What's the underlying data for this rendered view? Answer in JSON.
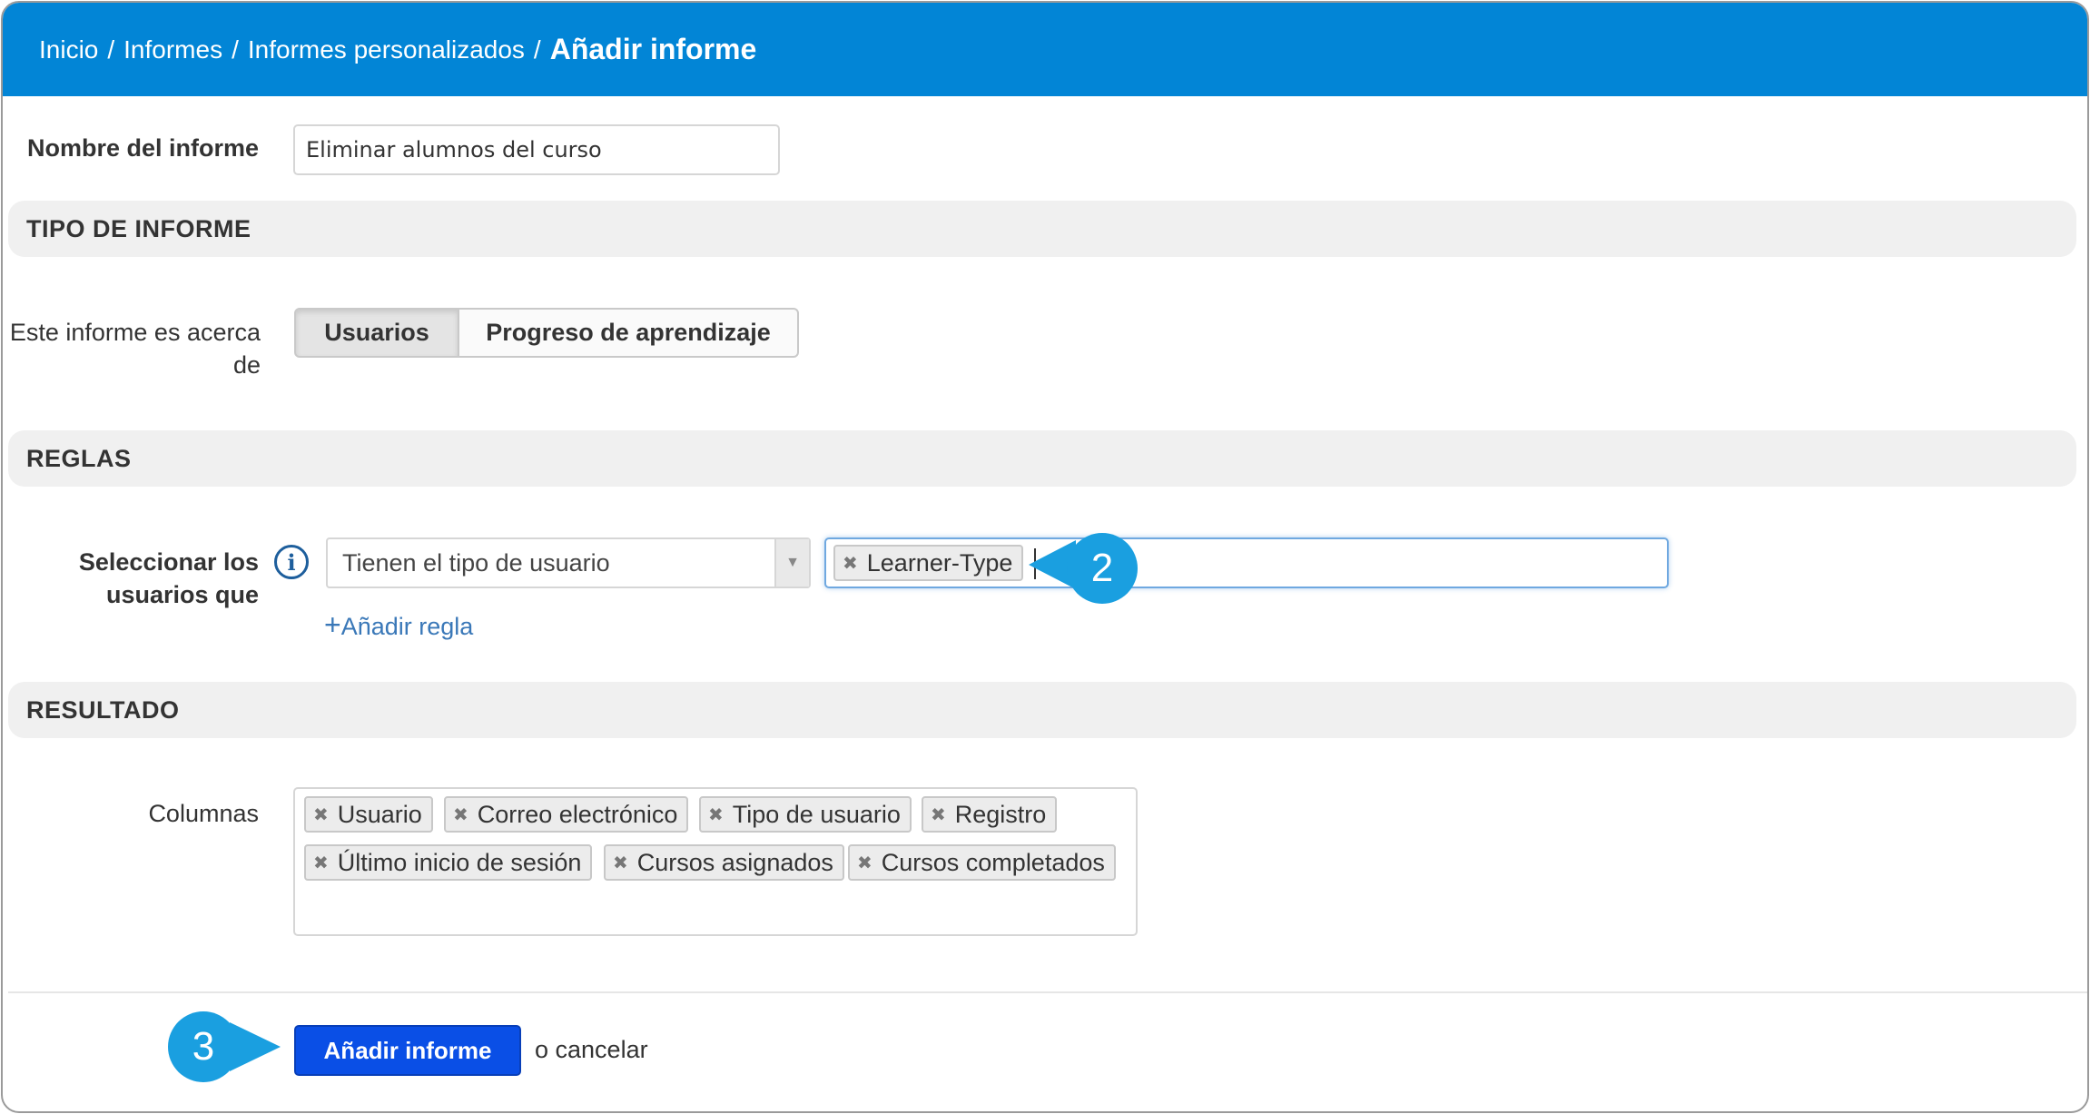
{
  "breadcrumb": {
    "items": [
      "Inicio",
      "Informes",
      "Informes personalizados"
    ],
    "separator": "/",
    "current": "Añadir informe"
  },
  "report_name": {
    "label": "Nombre del informe",
    "value": "Eliminar alumnos del curso"
  },
  "report_type": {
    "section_title": "TIPO DE INFORME",
    "about_label_line1": "Este informe es acerca",
    "about_label_line2": "de",
    "options": [
      "Usuarios",
      "Progreso de aprendizaje"
    ],
    "selected": "Usuarios"
  },
  "rules": {
    "section_title": "REGLAS",
    "select_label_line1": "Seleccionar los",
    "select_label_line2": "usuarios que",
    "condition": "Tienen el tipo de usuario",
    "value_tags": [
      "Learner-Type"
    ],
    "add_rule": "Añadir regla"
  },
  "result": {
    "section_title": "RESULTADO",
    "columns_label": "Columnas",
    "columns": [
      "Usuario",
      "Correo electrónico",
      "Tipo de usuario",
      "Registro",
      "Último inicio de sesión",
      "Cursos asignados",
      "Cursos completados"
    ]
  },
  "actions": {
    "submit": "Añadir informe",
    "cancel": "o cancelar"
  },
  "callouts": [
    "2",
    "3"
  ],
  "colors": {
    "header": "#0285d6",
    "callout": "#1a9fe0",
    "primary_button": "#0a4fe6",
    "link": "#3a78b8"
  }
}
